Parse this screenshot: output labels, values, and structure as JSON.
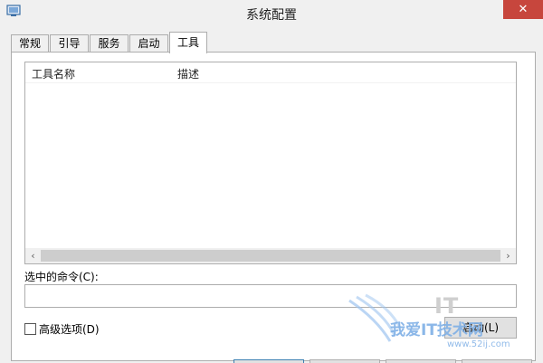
{
  "window": {
    "title": "系统配置",
    "close_glyph": "✕"
  },
  "tabs": [
    {
      "label": "常规"
    },
    {
      "label": "引导"
    },
    {
      "label": "服务"
    },
    {
      "label": "启动"
    },
    {
      "label": "工具",
      "active": true
    }
  ],
  "tools_list": {
    "columns": [
      "工具名称",
      "描述"
    ],
    "rows": [],
    "scroll_left_glyph": "‹",
    "scroll_right_glyph": "›"
  },
  "command": {
    "label": "选中的命令(C):",
    "value": ""
  },
  "advanced_option": {
    "label": "高级选项(D)",
    "checked": false
  },
  "launch_button": {
    "label": "启动(L)"
  },
  "watermark": {
    "text": "我爱IT技术网",
    "url": "www.52ij.com"
  },
  "colors": {
    "close_button": "#c7463d",
    "scrollbar_thumb": "#cdcdcd",
    "watermark": "#7fb0e6"
  }
}
